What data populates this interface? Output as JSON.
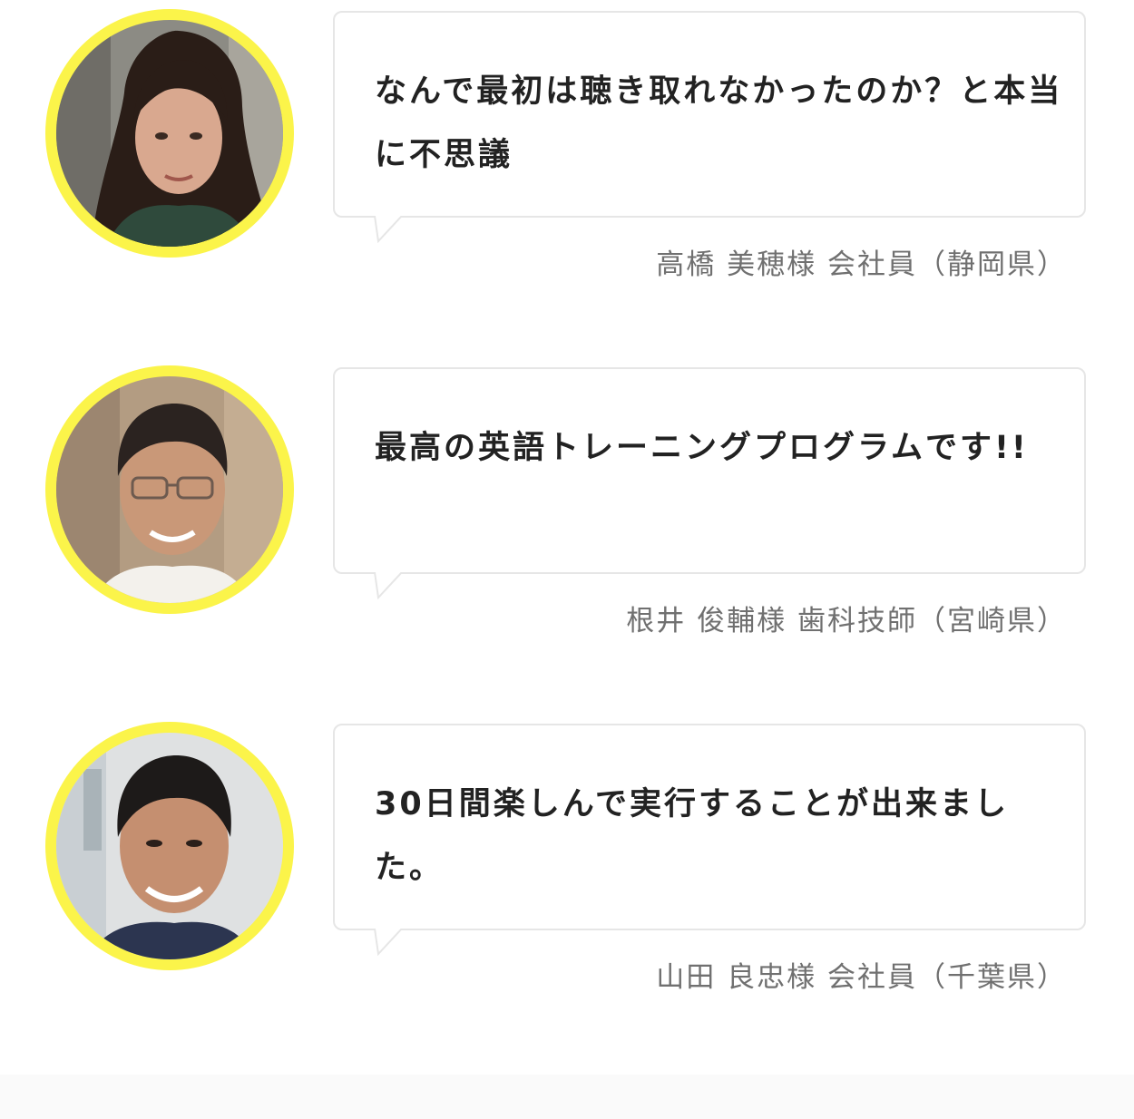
{
  "colors": {
    "avatar_ring": "#fbf44a",
    "bubble_border": "#e6e6e6",
    "quote_text": "#222222",
    "attribution_text": "#707070"
  },
  "testimonials": [
    {
      "quote": "なんで最初は聴き取れなかったのか？と本当に不思議",
      "attribution": "高橋 美穂様 会社員（静岡県）"
    },
    {
      "quote": "最高の英語トレーニングプログラムです!!",
      "attribution": "根井 俊輔様 歯科技師（宮崎県）"
    },
    {
      "quote": "30日間楽しんで実行することが出来ました。",
      "attribution": "山田 良忠様 会社員（千葉県）"
    }
  ]
}
